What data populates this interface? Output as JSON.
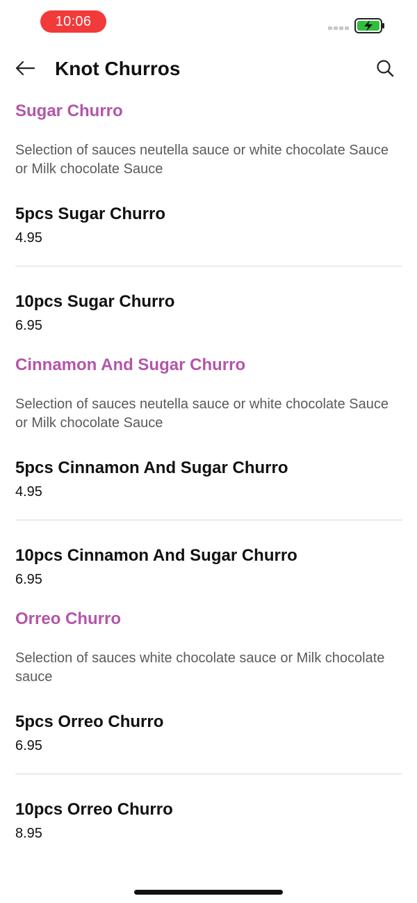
{
  "status_bar": {
    "time": "10:06",
    "time_pill_color": "#f23a3a",
    "battery_color": "#2fbf3a"
  },
  "header": {
    "title": "Knot Churros"
  },
  "theme": {
    "section_title_color": "#b455aa",
    "home_indicator_color": "#111111"
  },
  "sections": [
    {
      "title": "Sugar Churro",
      "description": "Selection of sauces neutella sauce or white chocolate Sauce or Milk chocolate Sauce",
      "items": [
        {
          "name": "5pcs Sugar Churro",
          "price": "4.95"
        },
        {
          "name": "10pcs Sugar Churro",
          "price": "6.95"
        }
      ]
    },
    {
      "title": "Cinnamon And Sugar Churro",
      "description": "Selection of sauces neutella sauce or white chocolate Sauce or Milk chocolate Sauce",
      "items": [
        {
          "name": "5pcs Cinnamon And Sugar Churro",
          "price": "4.95"
        },
        {
          "name": "10pcs Cinnamon And Sugar Churro",
          "price": "6.95"
        }
      ]
    },
    {
      "title": "Orreo Churro",
      "description": "Selection of sauces white chocolate sauce or Milk chocolate sauce",
      "items": [
        {
          "name": "5pcs Orreo Churro",
          "price": "6.95"
        },
        {
          "name": "10pcs Orreo Churro",
          "price": "8.95"
        }
      ]
    }
  ]
}
